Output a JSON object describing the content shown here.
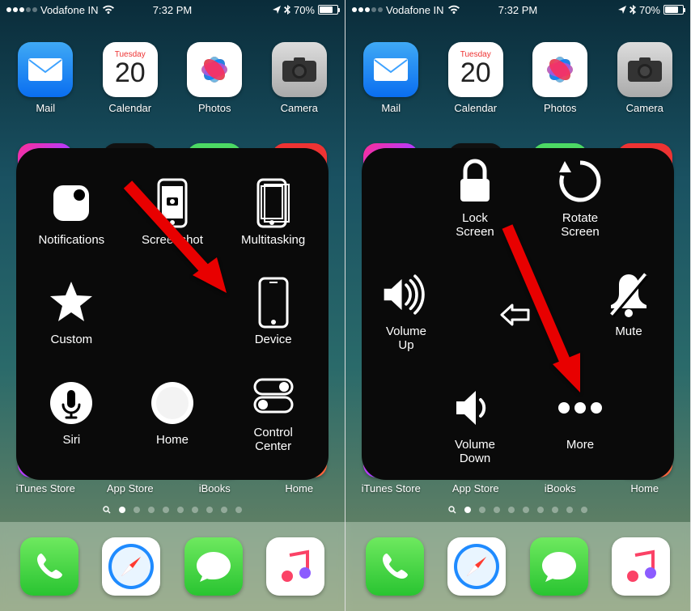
{
  "status": {
    "carrier": "Vodafone IN",
    "time": "7:32 PM",
    "battery_pct": "70%",
    "battery_fill": 70
  },
  "apps_row1": [
    {
      "id": "mail",
      "label": "Mail"
    },
    {
      "id": "calendar",
      "label": "Calendar",
      "day": "20",
      "weekday": "Tuesday"
    },
    {
      "id": "photos",
      "label": "Photos"
    },
    {
      "id": "camera",
      "label": "Camera"
    }
  ],
  "apps_row5": [
    {
      "id": "itunes",
      "label": "iTunes Store"
    },
    {
      "id": "appstore",
      "label": "App Store"
    },
    {
      "id": "ibooks",
      "label": "iBooks"
    },
    {
      "id": "home",
      "label": "Home"
    }
  ],
  "dock": [
    {
      "id": "phone",
      "label": "Phone"
    },
    {
      "id": "safari",
      "label": "Safari"
    },
    {
      "id": "messages",
      "label": "Messages"
    },
    {
      "id": "music",
      "label": "Music"
    }
  ],
  "at_left": {
    "items": [
      {
        "id": "notifications",
        "label": "Notifications"
      },
      {
        "id": "screenshot",
        "label": "Screenshot"
      },
      {
        "id": "multitasking",
        "label": "Multitasking"
      },
      {
        "id": "custom",
        "label": "Custom"
      },
      {
        "id": "empty",
        "label": ""
      },
      {
        "id": "device",
        "label": "Device"
      },
      {
        "id": "siri",
        "label": "Siri"
      },
      {
        "id": "home",
        "label": "Home"
      },
      {
        "id": "control-center",
        "label": "Control\nCenter"
      }
    ]
  },
  "at_right": {
    "items": [
      {
        "id": "lock-screen",
        "label": "Lock\nScreen"
      },
      {
        "id": "rotate-screen",
        "label": "Rotate\nScreen"
      },
      {
        "id": "volume-up",
        "label": "Volume\nUp"
      },
      {
        "id": "back",
        "label": ""
      },
      {
        "id": "mute",
        "label": "Mute"
      },
      {
        "id": "volume-down",
        "label": "Volume\nDown"
      },
      {
        "id": "more",
        "label": "More"
      }
    ]
  }
}
